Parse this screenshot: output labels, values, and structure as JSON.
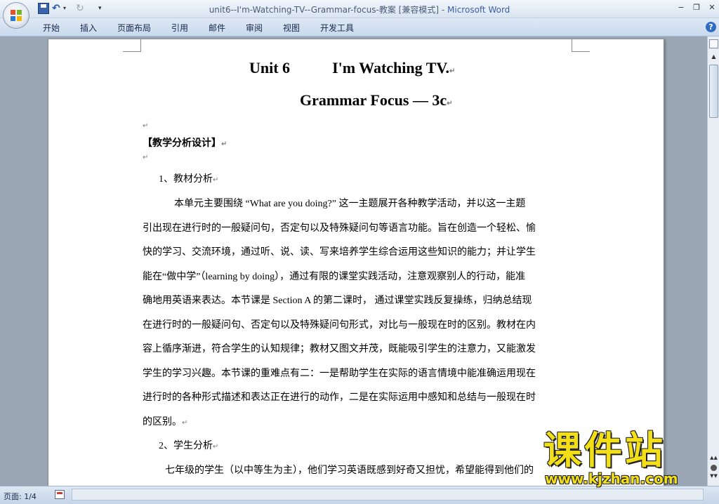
{
  "window": {
    "title_doc": "unit6--I'm-Watching-TV--Grammar-focus-教案 [兼容模式]",
    "title_sep": " - ",
    "title_app": "Microsoft Word"
  },
  "ribbon": {
    "tabs": [
      "开始",
      "插入",
      "页面布局",
      "引用",
      "邮件",
      "审阅",
      "视图",
      "开发工具"
    ]
  },
  "icons": {
    "office_button": "office-logo-icon",
    "save": "save-icon",
    "undo": "undo-icon",
    "redo": "redo-icon",
    "help": "help-icon"
  },
  "document": {
    "title_line1_left": "Unit 6",
    "title_line1_right": "I'm Watching TV.",
    "title_line2": "Grammar Focus — 3c",
    "section_heading": "【教学分析设计】",
    "subheading1": "1、教材分析",
    "para1": [
      "本单元主要围绕  “What are you doing?”  这一主题展开各种教学活动，并以这一主题",
      "引出现在进行时的一般疑问句，否定句以及特殊疑问句等语言功能。旨在创造一个轻松、愉",
      "快的学习、交流环境，通过听、说、读、写来培养学生综合运用这些知识的能力；并让学生",
      "能在“做中学”（learning by doing），通过有限的课堂实践活动，注意观察别人的行动，能准",
      "确地用英语来表达。本节课是 Section A 的第二课时，  通过课堂实践反复操练，归纳总结现",
      "在进行时的一般疑问句、否定句以及特殊疑问句形式，对比与一般现在时的区别。教材在内",
      "容上循序渐进，符合学生的认知规律；教材又图文并茂，既能吸引学生的注意力，又能激发",
      "学生的学习兴趣。本节课的重难点有二：一是帮助学生在实际的语言情境中能准确运用现在",
      "进行时的各种形式描述和表达正在进行的动作，二是在实际运用中感知和总结与一般现在时",
      "的区别。"
    ],
    "subheading2": "2、学生分析",
    "para2_first": "七年级的学生（以中等生为主），他们学习英语既感到好奇又担忧，希望能得到他们的",
    "paragraph_mark": "↵"
  },
  "statusbar": {
    "page_indicator": "页面: 1/4"
  },
  "watermark": {
    "title": "课件站",
    "url": "www.kjzhan.com"
  }
}
